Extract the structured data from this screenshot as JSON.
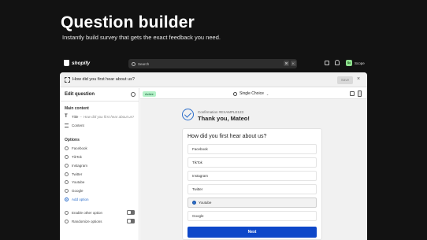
{
  "hero": {
    "title": "Question builder",
    "subtitle": "Instantly build survey that gets the exact feedback you need."
  },
  "topbar": {
    "brand": "shopify",
    "search_placeholder": "Search",
    "shortcut_keys": [
      "⌘",
      "K"
    ],
    "store_initials": "Sc",
    "store_name": "Scope"
  },
  "window": {
    "title": "How did you first hear about us?",
    "save_label": "Save",
    "close_label": "×"
  },
  "editor": {
    "heading": "Edit question",
    "main_content_label": "Main content",
    "title_row_label": "Title",
    "title_row_value": "How did you first hear about us?",
    "content_row_label": "Content",
    "options_label": "Options",
    "options": [
      "Facebook",
      "TikTok",
      "Instagram",
      "Twitter",
      "Youtube",
      "Google"
    ],
    "add_option_label": "Add option",
    "settings": [
      {
        "label": "Enable other option",
        "enabled": true
      },
      {
        "label": "Randomize options",
        "enabled": true
      }
    ]
  },
  "preview": {
    "status_badge": "Active",
    "question_type": "Single Choice",
    "confirmation_id": "Confirmation #EXAMPLE123",
    "thank_you": "Thank you, Mateo!",
    "question": "How did you first hear about us?",
    "choices": [
      "Facebook",
      "TikTok",
      "Instagram",
      "Twitter",
      "Youtube",
      "Google"
    ],
    "selected_choice": "Youtube",
    "next_label": "Next"
  },
  "colors": {
    "background": "#121212",
    "accent": "#0d47c9",
    "active_badge": "#b4f2c8",
    "link": "#2c6ecb"
  }
}
